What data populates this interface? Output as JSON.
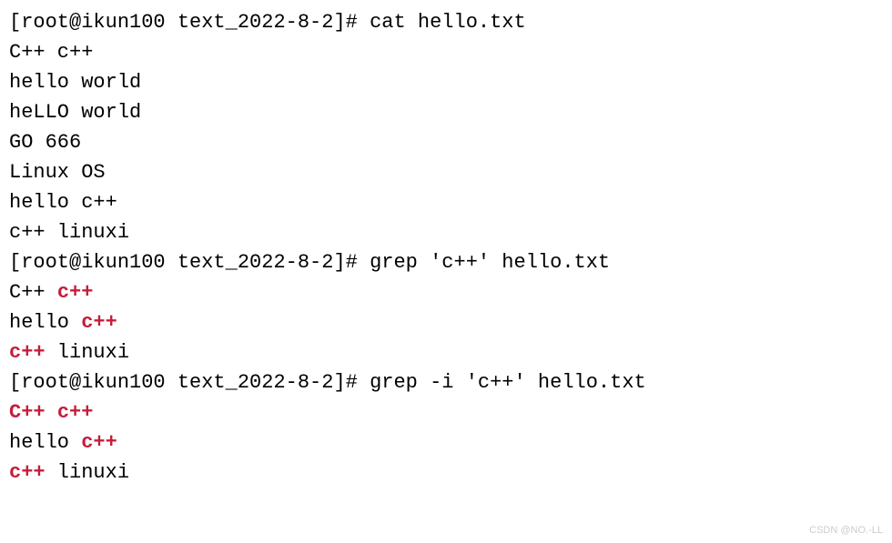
{
  "prompt_prefix": "[root@ikun100 text_2022-8-2]# ",
  "commands": {
    "cat": "cat hello.txt",
    "grep1": "grep 'c++' hello.txt",
    "grep2": "grep -i 'c++' hello.txt"
  },
  "cat_output": [
    "C++ c++",
    "hello world",
    "heLLO world",
    "GO 666",
    "Linux OS",
    "hello c++",
    "c++ linuxi"
  ],
  "grep1_output": [
    {
      "pre": "C++ ",
      "m1": "c++",
      "mid": "",
      "m2": "",
      "post": ""
    },
    {
      "pre": "hello ",
      "m1": "c++",
      "mid": "",
      "m2": "",
      "post": ""
    },
    {
      "pre": "",
      "m1": "c++",
      "mid": " linuxi",
      "m2": "",
      "post": ""
    }
  ],
  "grep2_output": [
    {
      "pre": "",
      "m1": "C++",
      "mid": " ",
      "m2": "c++",
      "post": ""
    },
    {
      "pre": "hello ",
      "m1": "c++",
      "mid": "",
      "m2": "",
      "post": ""
    },
    {
      "pre": "",
      "m1": "c++",
      "mid": " linuxi",
      "m2": "",
      "post": ""
    }
  ],
  "watermark": "CSDN @NO.-LL"
}
